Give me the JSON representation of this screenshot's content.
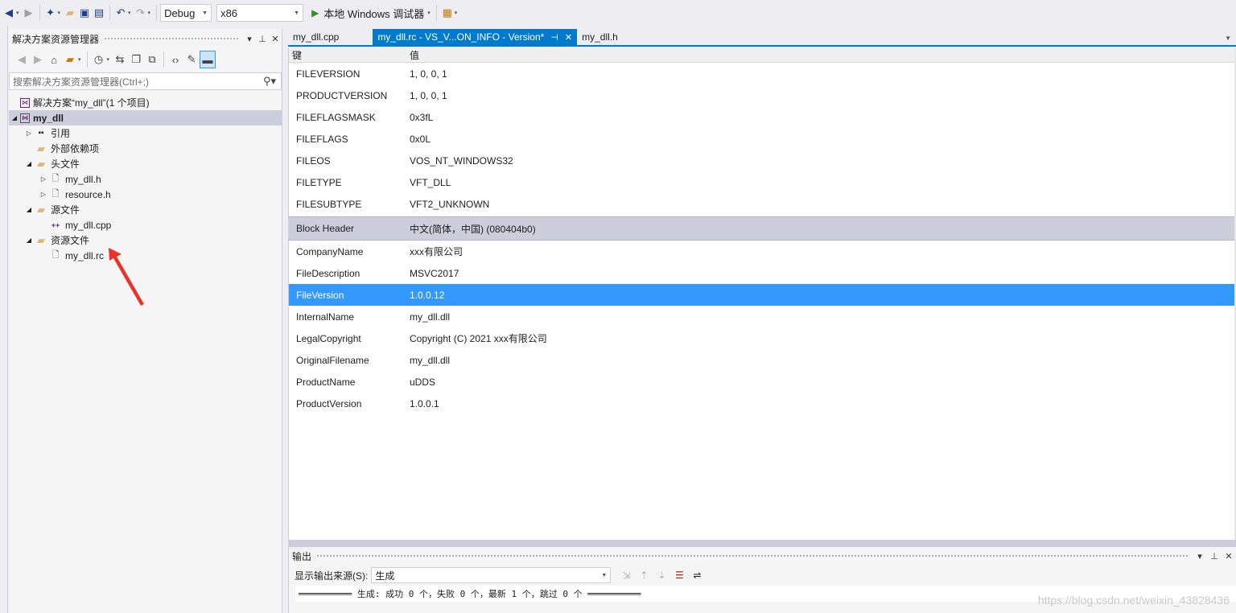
{
  "toolbar": {
    "config": "Debug",
    "platform": "x86",
    "run_label": "本地 Windows 调试器"
  },
  "solution_explorer": {
    "title": "解决方案资源管理器",
    "search_placeholder": "搜索解决方案资源管理器(Ctrl+;)",
    "tree": {
      "solution": "解决方案“my_dll”(1 个项目)",
      "project": "my_dll",
      "references": "引用",
      "external_deps": "外部依赖项",
      "headers_folder": "头文件",
      "header1": "my_dll.h",
      "header2": "resource.h",
      "sources_folder": "源文件",
      "source1": "my_dll.cpp",
      "resources_folder": "资源文件",
      "resource1": "my_dll.rc"
    }
  },
  "tabs": [
    {
      "label": "my_dll.cpp"
    },
    {
      "label": "my_dll.rc - VS_V...ON_INFO - Version*"
    },
    {
      "label": "my_dll.h"
    }
  ],
  "version_editor": {
    "col_key": "键",
    "col_value": "值",
    "fixed_rows": [
      {
        "key": "FILEVERSION",
        "value": "1, 0, 0, 1"
      },
      {
        "key": "PRODUCTVERSION",
        "value": "1, 0, 0, 1"
      },
      {
        "key": "FILEFLAGSMASK",
        "value": "0x3fL"
      },
      {
        "key": "FILEFLAGS",
        "value": "0x0L"
      },
      {
        "key": "FILEOS",
        "value": "VOS_NT_WINDOWS32"
      },
      {
        "key": "FILETYPE",
        "value": "VFT_DLL"
      },
      {
        "key": "FILESUBTYPE",
        "value": "VFT2_UNKNOWN"
      }
    ],
    "block_header": {
      "key": "Block Header",
      "value": "中文(简体，中国) (080404b0)"
    },
    "string_rows": [
      {
        "key": "CompanyName",
        "value": "xxx有限公司"
      },
      {
        "key": "FileDescription",
        "value": "MSVC2017"
      },
      {
        "key": "FileVersion",
        "value": "1.0.0.12"
      },
      {
        "key": "InternalName",
        "value": "my_dll.dll"
      },
      {
        "key": "LegalCopyright",
        "value": "Copyright (C) 2021 xxx有限公司"
      },
      {
        "key": "OriginalFilename",
        "value": "my_dll.dll"
      },
      {
        "key": "ProductName",
        "value": "uDDS"
      },
      {
        "key": "ProductVersion",
        "value": "1.0.0.1"
      }
    ]
  },
  "output": {
    "title": "输出",
    "source_label": "显示输出来源(S):",
    "source_value": "生成",
    "text": "══════════ 生成: 成功 0 个，失败 0 个，最新 1 个，跳过 0 个 ══════════",
    "watermark": "https://blog.csdn.net/weixin_43828436"
  },
  "colors": {
    "accent": "#007acc",
    "selection": "#3399ff",
    "annotation_arrow": "#e8322a"
  }
}
